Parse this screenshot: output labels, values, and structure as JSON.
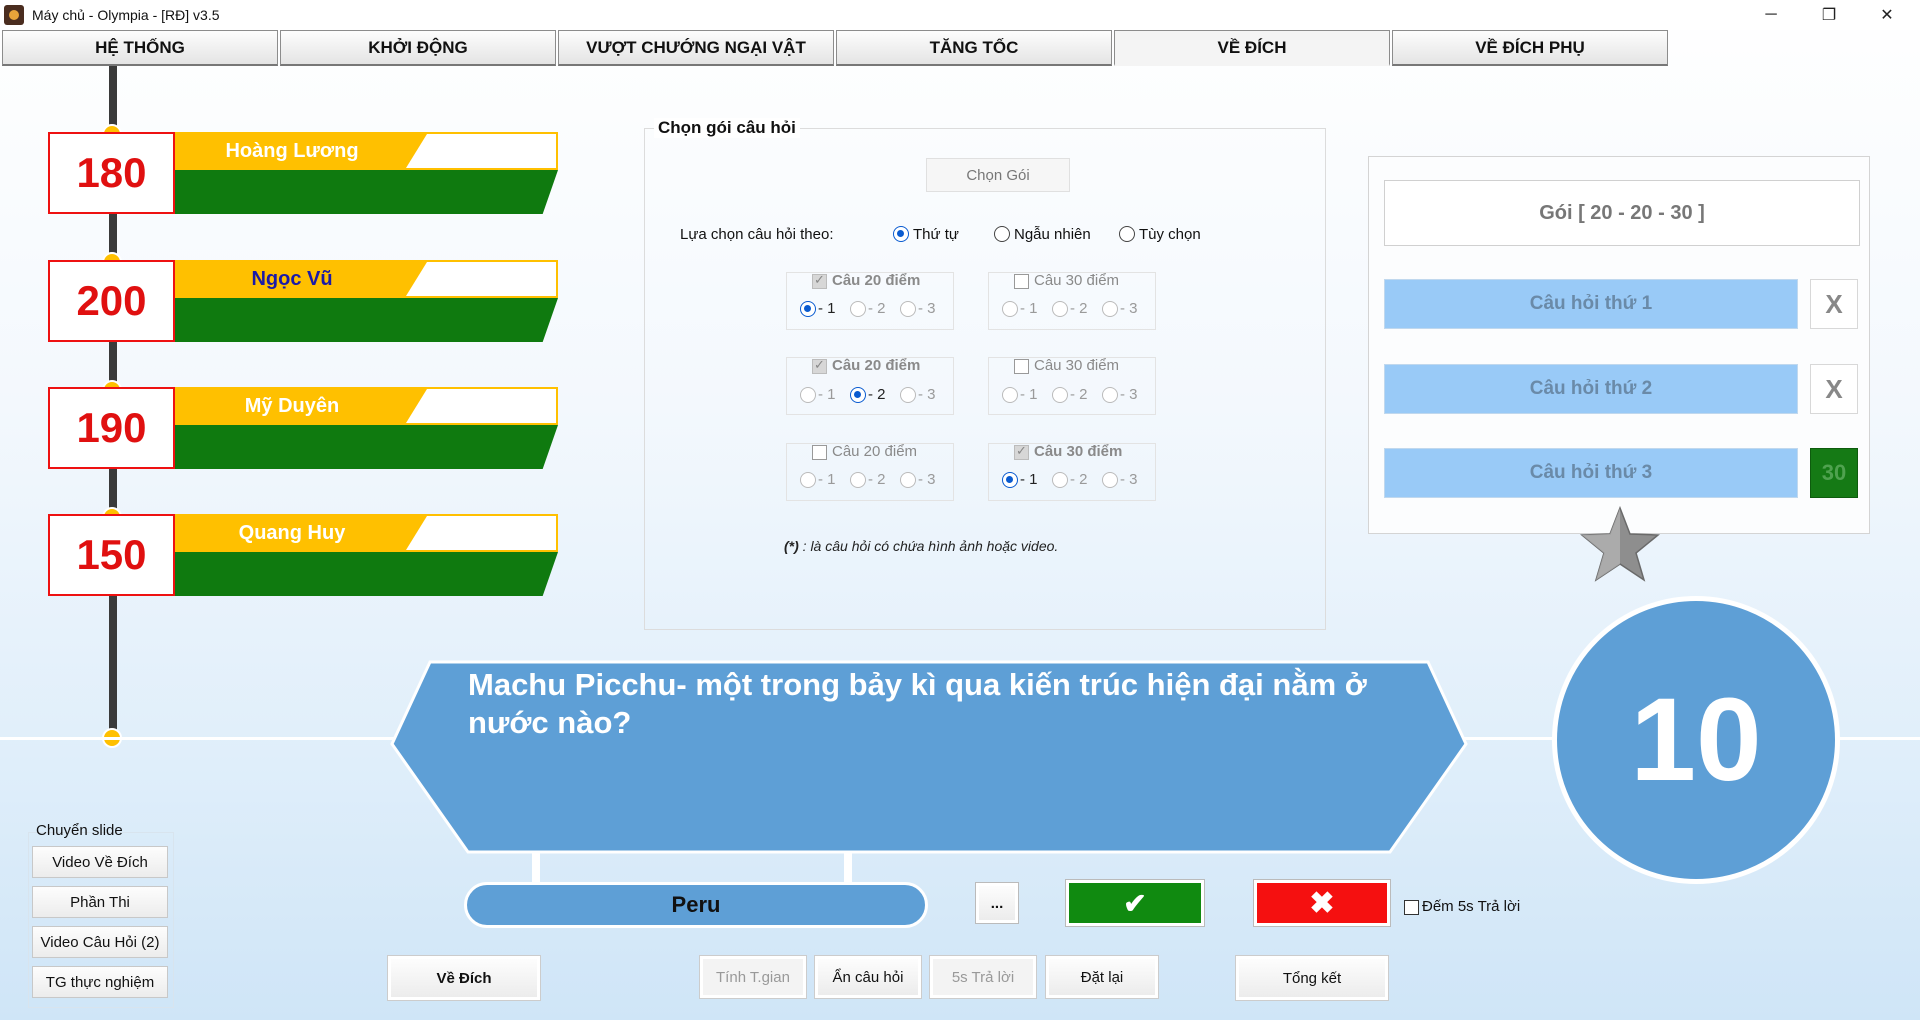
{
  "window": {
    "title": "Máy chủ - Olympia - [RĐ] v3.5",
    "minimize": "─",
    "maximize": "❐",
    "close": "✕"
  },
  "tabs": [
    {
      "label": "HỆ THỐNG"
    },
    {
      "label": "KHỞI ĐỘNG"
    },
    {
      "label": "VƯỢT CHƯỚNG NGẠI VẬT"
    },
    {
      "label": "TĂNG TỐC"
    },
    {
      "label": "VỀ ĐÍCH",
      "active": true
    },
    {
      "label": "VỀ ĐÍCH PHỤ"
    }
  ],
  "players": [
    {
      "name": "Hoàng Lương",
      "score": "180"
    },
    {
      "name": "Ngọc Vũ",
      "score": "200"
    },
    {
      "name": "Mỹ Duyên",
      "score": "190"
    },
    {
      "name": "Quang Huy",
      "score": "150"
    }
  ],
  "package_chooser": {
    "title": "Chọn gói câu hỏi",
    "choose_button": "Chọn Gói",
    "select_by_label": "Lựa chọn câu hỏi theo:",
    "modes": [
      {
        "label": "Thứ tự",
        "checked": true
      },
      {
        "label": "Ngẫu nhiên",
        "checked": false
      },
      {
        "label": "Tùy chọn",
        "checked": false
      }
    ],
    "rows": [
      {
        "q20": {
          "label": "Câu 20 điểm",
          "checked": true,
          "selected": 1
        },
        "q30": {
          "label": "Câu 30 điểm",
          "checked": false,
          "selected": 0
        }
      },
      {
        "q20": {
          "label": "Câu 20 điểm",
          "checked": true,
          "selected": 2
        },
        "q30": {
          "label": "Câu 30 điểm",
          "checked": false,
          "selected": 0
        }
      },
      {
        "q20": {
          "label": "Câu 20 điểm",
          "checked": false,
          "selected": 0
        },
        "q30": {
          "label": "Câu 30 điểm",
          "checked": true,
          "selected": 1
        }
      }
    ],
    "option_labels": [
      "- 1",
      "- 2",
      "- 3"
    ],
    "note_mark": "(*)",
    "note_text": ": là câu hỏi có chứa hình ảnh hoặc video."
  },
  "right_panel": {
    "package_label": "Gói [ 20 - 20 - 30 ]",
    "questions": [
      {
        "label": "Câu hỏi thứ 1",
        "status": "X"
      },
      {
        "label": "Câu hỏi thứ 2",
        "status": "X"
      },
      {
        "label": "Câu hỏi thứ 3",
        "status": "30"
      }
    ]
  },
  "question": {
    "text": "Machu Picchu- một trong bảy kì qua kiến trúc hiện đại nằm ở nước nào?",
    "answer": "Peru",
    "timer": "10"
  },
  "controls": {
    "more_button": "...",
    "correct_icon": "✔",
    "wrong_icon": "✖",
    "count_5s_label": "Đếm 5s Trả lời",
    "ve_dich_button": "Về Đích",
    "calc_time_button": "Tính T.gian",
    "hide_question_button": "Ẩn câu hỏi",
    "answer_5s_button": "5s Trả lời",
    "reset_button": "Đặt lại",
    "summary_button": "Tổng kết"
  },
  "slide_panel": {
    "title": "Chuyển slide",
    "buttons": [
      "Video Về Đích",
      "Phần Thi",
      "Video Câu Hỏi (2)",
      "TG thực nghiệm"
    ]
  },
  "colors": {
    "score_red": "#e01010",
    "name_gold": "#ffc000",
    "bar_green": "#0f7a0f",
    "question_blue": "#5e9fd6",
    "correct_green": "#108a10",
    "wrong_red": "#f51010"
  }
}
